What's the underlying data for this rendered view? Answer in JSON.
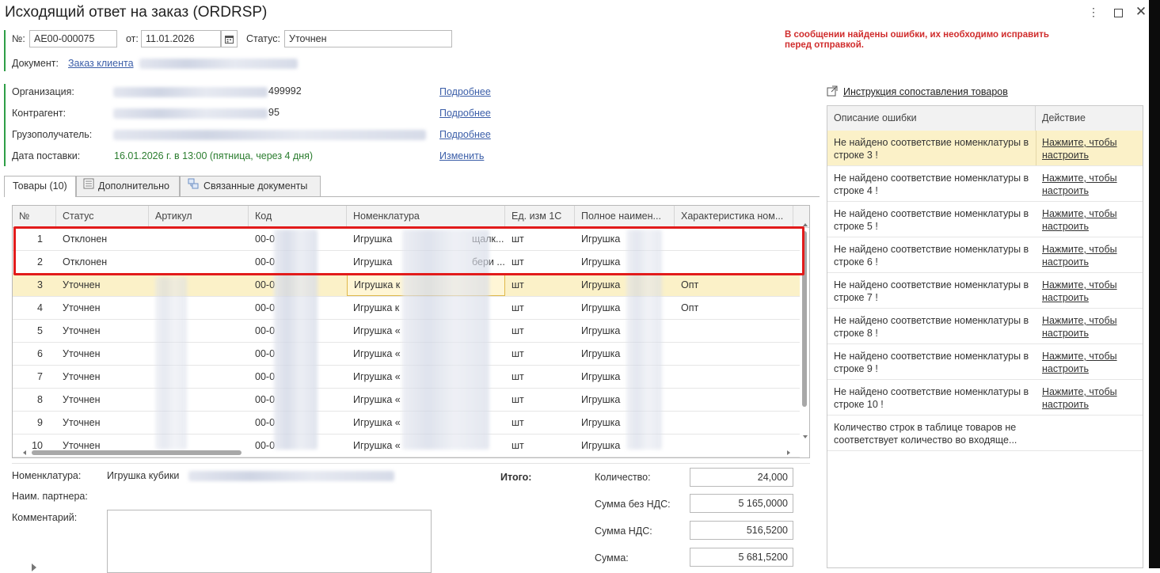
{
  "window": {
    "title": "Исходящий ответ на заказ (ORDRSP)"
  },
  "header": {
    "number_label": "№:",
    "number_value": "АЕ00-000075",
    "date_label": "от:",
    "date_value": "11.01.2026",
    "status_label": "Статус:",
    "status_value": "Уточнен",
    "document_label": "Документ:",
    "document_link": "Заказ клиента",
    "error_message": "В сообщении найдены ошибки, их необходимо исправить перед отправкой."
  },
  "info": {
    "org_label": "Организация:",
    "org_value_tail": "499992",
    "org_link": "Подробнее",
    "contractor_label": "Контрагент:",
    "contractor_value_tail": "95",
    "contractor_link": "Подробнее",
    "consignee_label": "Грузополучатель:",
    "consignee_link": "Подробнее",
    "delivery_label": "Дата поставки:",
    "delivery_value": "16.01.2026 г. в 13:00 (пятница, через 4 дня)",
    "delivery_link": "Изменить"
  },
  "tabs": [
    {
      "label": "Товары (10)"
    },
    {
      "label": "Дополнительно"
    },
    {
      "label": "Связанные документы"
    }
  ],
  "grid": {
    "columns": [
      "№",
      "Статус",
      "Артикул",
      "Код",
      "Номенклатура",
      "Ед. изм 1С",
      "Полное наимен...",
      "Характеристика ном..."
    ],
    "rows": [
      {
        "n": "1",
        "status": "Отклонен",
        "code": "00-0",
        "nom": "Игрушка",
        "nom_tail": "щалк...",
        "unit": "шт",
        "full": "Игрушка",
        "char": ""
      },
      {
        "n": "2",
        "status": "Отклонен",
        "code": "00-0",
        "nom": "Игрушка",
        "nom_tail": "бери ...",
        "unit": "шт",
        "full": "Игрушка",
        "char": ""
      },
      {
        "n": "3",
        "status": "Уточнен",
        "code": "00-0",
        "nom": "Игрушка к",
        "nom_tail": "",
        "unit": "шт",
        "full": "Игрушка",
        "char": "Опт"
      },
      {
        "n": "4",
        "status": "Уточнен",
        "code": "00-0",
        "nom": "Игрушка к",
        "nom_tail": "",
        "unit": "шт",
        "full": "Игрушка",
        "char": "Опт"
      },
      {
        "n": "5",
        "status": "Уточнен",
        "code": "00-0",
        "nom": "Игрушка «",
        "nom_tail": "",
        "unit": "шт",
        "full": "Игрушка",
        "char": ""
      },
      {
        "n": "6",
        "status": "Уточнен",
        "code": "00-0",
        "nom": "Игрушка «",
        "nom_tail": "",
        "unit": "шт",
        "full": "Игрушка",
        "char": ""
      },
      {
        "n": "7",
        "status": "Уточнен",
        "code": "00-0",
        "nom": "Игрушка «",
        "nom_tail": "",
        "unit": "шт",
        "full": "Игрушка",
        "char": ""
      },
      {
        "n": "8",
        "status": "Уточнен",
        "code": "00-0",
        "nom": "Игрушка «",
        "nom_tail": "",
        "unit": "шт",
        "full": "Игрушка",
        "char": ""
      },
      {
        "n": "9",
        "status": "Уточнен",
        "code": "00-0",
        "nom": "Игрушка «",
        "nom_tail": "",
        "unit": "шт",
        "full": "Игрушка",
        "char": ""
      },
      {
        "n": "10",
        "status": "Уточнен",
        "code": "00-0",
        "nom": "Игрушка «",
        "nom_tail": "",
        "unit": "шт",
        "full": "Игрушка",
        "char": ""
      }
    ]
  },
  "details": {
    "nom_label": "Номенклатура:",
    "nom_value": "Игрушка кубики",
    "partner_label": "Наим. партнера:",
    "comment_label": "Комментарий:",
    "totals_label": "Итого:",
    "qty_label": "Количество:",
    "qty_value": "24,000",
    "sum_novat_label": "Сумма без НДС:",
    "sum_novat_value": "5 165,0000",
    "vat_label": "Сумма НДС:",
    "vat_value": "516,5200",
    "sum_label": "Сумма:",
    "sum_value": "5 681,5200"
  },
  "errors_panel": {
    "instruction_link": "Инструкция сопоставления товаров",
    "col_desc": "Описание ошибки",
    "col_action": "Действие",
    "rows": [
      {
        "desc": "Не найдено соответствие номенклатуры в строке 3 !",
        "action": "Нажмите, чтобы настроить"
      },
      {
        "desc": "Не найдено соответствие номенклатуры в строке 4 !",
        "action": "Нажмите, чтобы настроить"
      },
      {
        "desc": "Не найдено соответствие номенклатуры в строке 5 !",
        "action": "Нажмите, чтобы настроить"
      },
      {
        "desc": "Не найдено соответствие номенклатуры в строке 6 !",
        "action": "Нажмите, чтобы настроить"
      },
      {
        "desc": "Не найдено соответствие номенклатуры в строке 7 !",
        "action": "Нажмите, чтобы настроить"
      },
      {
        "desc": "Не найдено соответствие номенклатуры в строке 8 !",
        "action": "Нажмите, чтобы настроить"
      },
      {
        "desc": "Не найдено соответствие номенклатуры в строке 9 !",
        "action": "Нажмите, чтобы настроить"
      },
      {
        "desc": "Не найдено соответствие номенклатуры в строке 10 !",
        "action": "Нажмите, чтобы настроить"
      },
      {
        "desc": "Количество строк в таблице товаров не соответствует количество во входяще...",
        "action": ""
      }
    ]
  },
  "colors": {
    "error": "#d02d2d",
    "link": "#3b5ea8",
    "selected_row": "#fbf1c8",
    "highlight_box": "#e21b1b",
    "accent_green": "#2e9e46"
  }
}
